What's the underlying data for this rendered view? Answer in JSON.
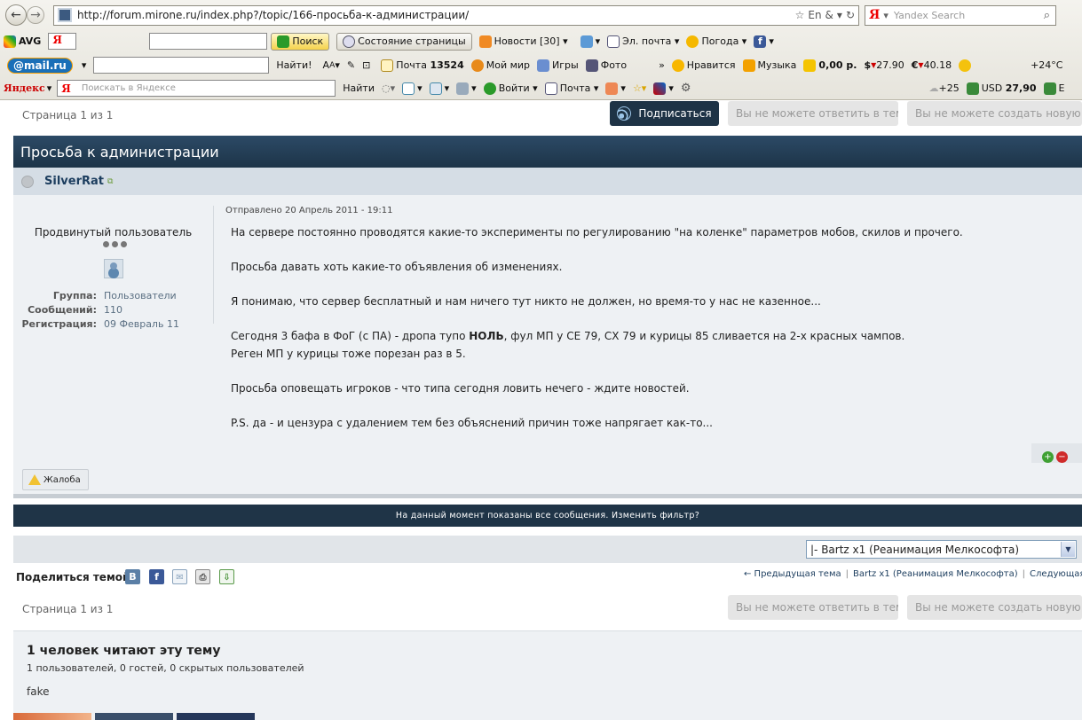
{
  "browser": {
    "url": "http://forum.mirone.ru/index.php?/topic/166-просьба-к-администрации/",
    "search_placeholder": "Yandex Search",
    "toolbar_avg": {
      "logo": "AVG",
      "search_button": "Поиск",
      "page_status": "Состояние страницы",
      "news": "Новости [30]",
      "email": "Эл. почта",
      "weather": "Погода"
    },
    "toolbar_mailru": {
      "logo": "@mail.ru",
      "find": "Найти!",
      "mail": "Почта",
      "mail_count": "13524",
      "my_world": "Мой мир",
      "games": "Игры",
      "photo": "Фото",
      "more": "»",
      "likes": "Нравится",
      "music": "Музыка",
      "balance": "0,00 р.",
      "usd_symbol": "$",
      "usd": "27.90",
      "eur_symbol": "€",
      "eur": "40.18",
      "temp": "+24°C"
    },
    "toolbar_yandex": {
      "logo": "Яндекс",
      "search_placeholder": "Поискать в Яндексе",
      "find": "Найти",
      "login": "Войти",
      "mail": "Почта",
      "weather": "+25",
      "usd_label": "USD",
      "usd": "27,90",
      "tail": "E"
    }
  },
  "page": {
    "pagination": "Страница 1 из 1",
    "subscribe": "Подписаться",
    "cannot_reply": "Вы не можете ответить в тему",
    "cannot_create": "Вы не можете создать новую тему",
    "topic_title": "Просьба к администрации",
    "post": {
      "author": "SilverRat",
      "user_title": "Продвинутый пользователь",
      "info": [
        {
          "key": "Группа:",
          "value": "Пользователи"
        },
        {
          "key": "Сообщений:",
          "value": "110"
        },
        {
          "key": "Регистрация:",
          "value": "09 Февраль 11"
        }
      ],
      "posted": "Отправлено 20 Апрель 2011 - 19:11",
      "lines": [
        "На сервере постоянно проводятся какие-то эксперименты по регулированию \"на коленке\" параметров мобов, скилов и прочего.",
        "Просьба давать хоть какие-то объявления об изменениях.",
        "Я понимаю, что сервер бесплатный и нам ничего тут никто не должен, но время-то у нас не казенное...",
        "Сегодня 3 бафа в ФоГ (с ПА) - дропа тупо ",
        "НОЛЬ",
        ", фул МП у СЕ 79, СХ 79 и курицы 85 сливается на 2-х красных чампов.",
        "Реген МП у курицы тоже порезан раз в 5.",
        "Просьба оповещать игроков - что типа сегодня ловить нечего - ждите новостей.",
        "P.S. да - и цензура с удалением тем без объяснений причин тоже напрягает как-то..."
      ],
      "report": "Жалоба",
      "rep_plus": "+",
      "rep_minus": "−"
    },
    "filter_notice": "На данный момент показаны все сообщения. Изменить фильтр?",
    "jump_to": "|- Bartz x1 (Реанимация Мелкософта)",
    "share_label": "Поделиться темой:",
    "share_vk": "В",
    "share_fb": "f",
    "nav_prev": "← Предыдущая тема",
    "nav_forum": "Bartz x1 (Реанимация Мелкософта)",
    "nav_next": "Следующая тема",
    "online": {
      "title": "1 человек читают эту тему",
      "summary": "1 пользователей, 0 гостей, 0 скрытых пользователей",
      "users": "fake"
    }
  },
  "colors": {
    "header_dark": "#1f3447",
    "author_bar": "#d5dde5",
    "post_bg": "#eef1f4",
    "disabled_button": "#e5e5e5"
  }
}
